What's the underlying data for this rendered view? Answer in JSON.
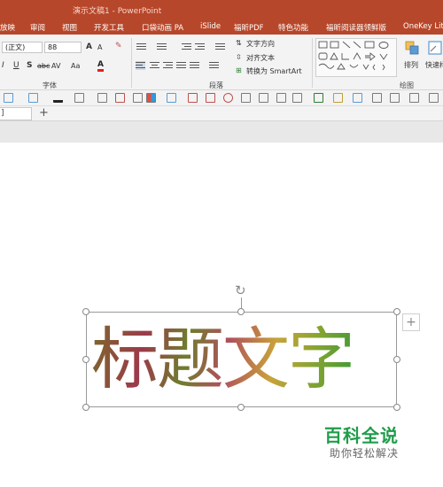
{
  "titlebar": {
    "title": "演示文稿1 - PowerPoint"
  },
  "menu": {
    "tabs": [
      "放映",
      "审阅",
      "视图",
      "开发工具",
      "口袋动画 PA",
      "iSlide",
      "福昕PDF",
      "特色功能",
      "福昕阅读器领鲜版",
      "OneKey Lite"
    ]
  },
  "ribbon": {
    "font_name": "(正文)",
    "font_size": "88",
    "font_group_label": "字体",
    "paragraph_group_label": "段落",
    "drawing_group_label": "绘图",
    "text_direction": "文字方向",
    "align_text": "对齐文本",
    "convert_smartart": "转换为 SmartArt",
    "arrange": "排列",
    "quick_styles": "快速样",
    "italic": "I",
    "underline": "U",
    "strike": "S",
    "abc": "abc",
    "av": "AV",
    "aa": "Aa",
    "font_color": "A",
    "grow": "A",
    "shrink": "A"
  },
  "tabs": {
    "doc_tab": "]",
    "add": "+"
  },
  "slide": {
    "title_text": "标题文字",
    "side_plus": "+"
  },
  "watermark": {
    "brand": "百科全说",
    "tagline": "助你轻松解决"
  }
}
